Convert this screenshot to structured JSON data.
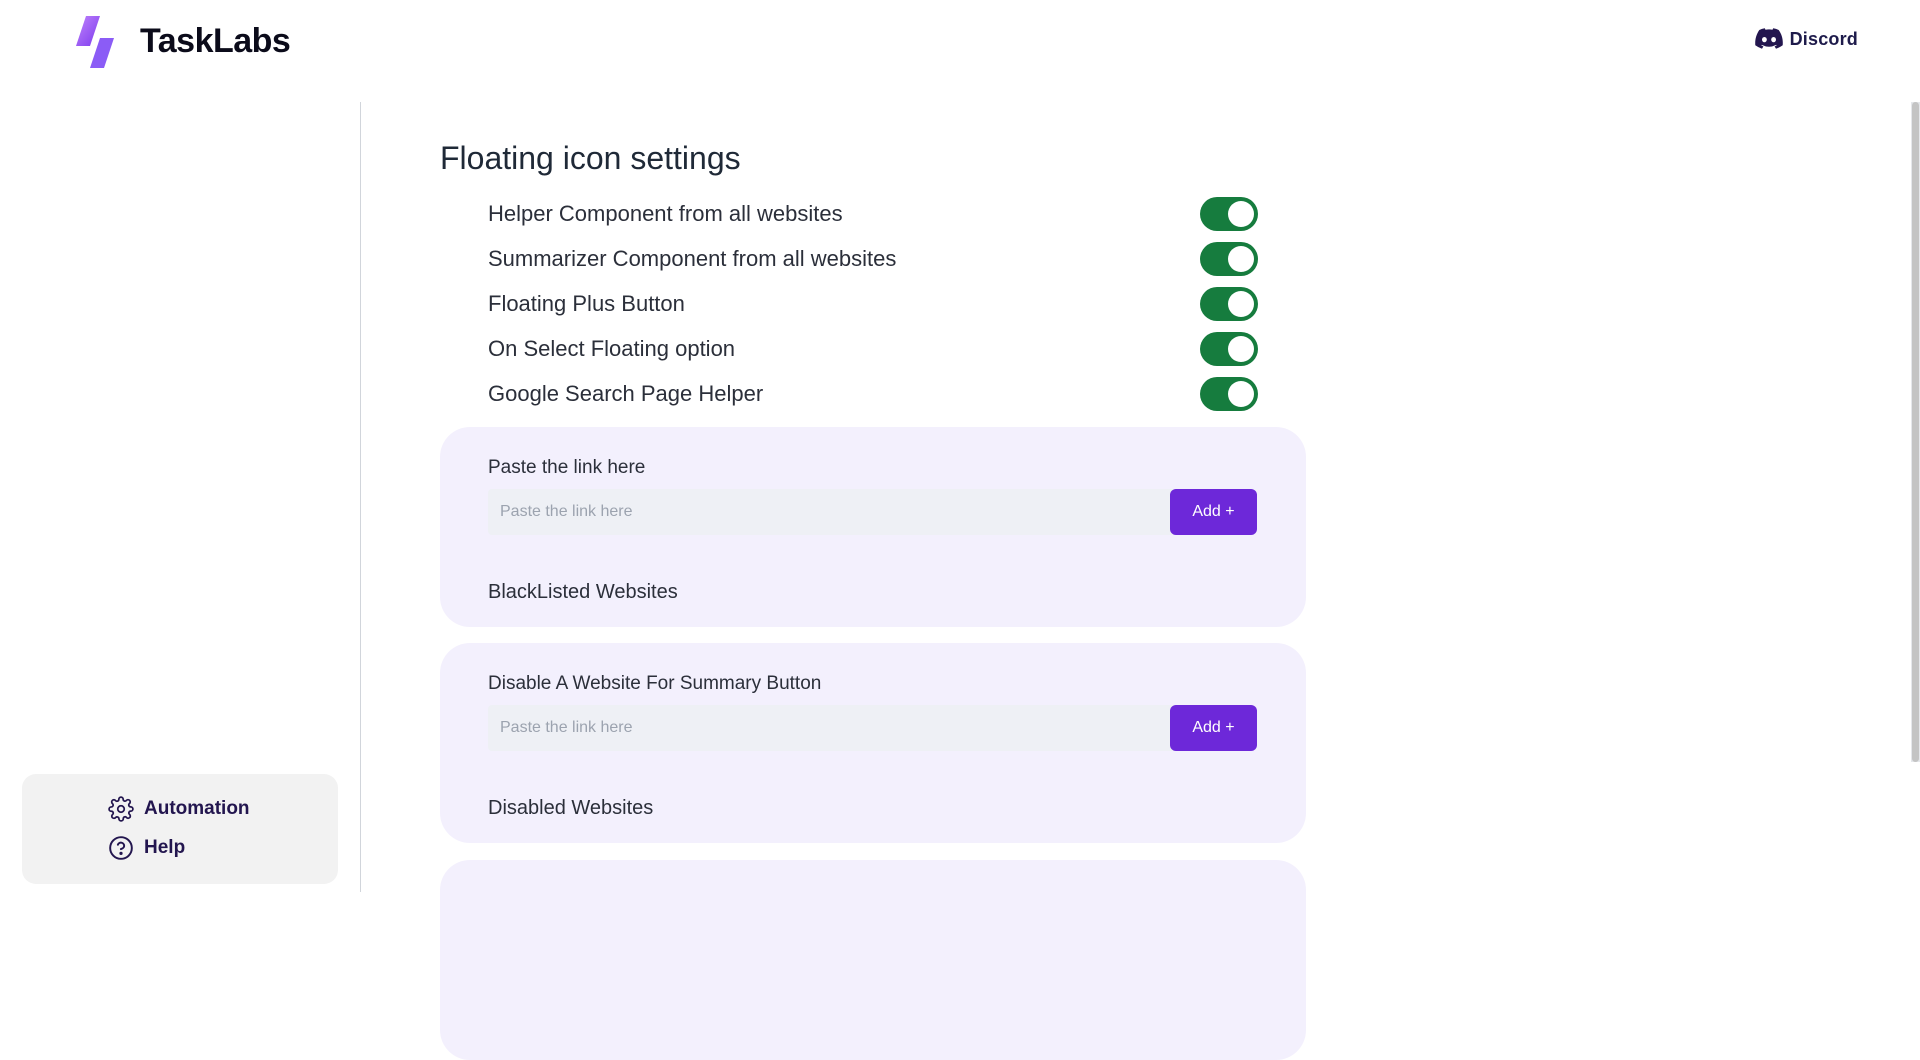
{
  "header": {
    "brand": "TaskLabs",
    "discord_label": "Discord",
    "brand_gradient": [
      "#7c3aed",
      "#c084fc"
    ],
    "discord_color": "#23164f"
  },
  "sidebar": {
    "items": [
      {
        "label": "Automation",
        "icon": "gear-icon"
      },
      {
        "label": "Help",
        "icon": "question-circle-icon"
      }
    ]
  },
  "main": {
    "title": "Floating icon settings",
    "toggles": [
      {
        "label": "Helper Component from all websites",
        "on": true
      },
      {
        "label": "Summarizer Component from all websites",
        "on": true
      },
      {
        "label": "Floating Plus Button",
        "on": true
      },
      {
        "label": "On Select Floating option",
        "on": true
      },
      {
        "label": "Google Search Page Helper",
        "on": true
      }
    ],
    "blacklist": {
      "title": "Paste the link here",
      "placeholder": "Paste the link here",
      "button": "Add +",
      "list_title": "BlackListed Websites"
    },
    "summary": {
      "title": "Disable A Website For Summary Button",
      "placeholder": "Paste the link here",
      "button": "Add +",
      "list_title": "Disabled Websites"
    }
  },
  "colors": {
    "toggle_on": "#167c3e",
    "accent": "#6d28d9",
    "card_bg": "#f3f0fd"
  }
}
